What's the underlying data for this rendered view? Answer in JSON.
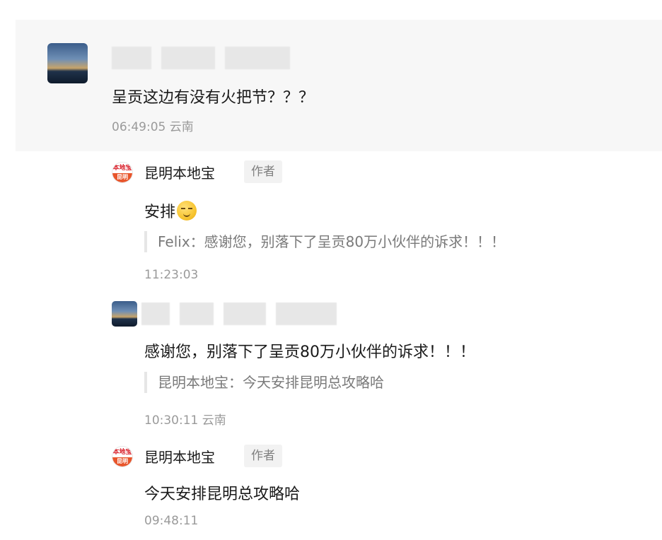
{
  "comment": {
    "username_blurred": true,
    "text": "呈贡这边有没有火把节？？？",
    "meta": "06:49:05 云南"
  },
  "replies": [
    {
      "author": "昆明本地宝",
      "badge": "作者",
      "text": "安排",
      "emoji": "smirk-emoji",
      "quote": "Felix：感谢您，别落下了呈贡80万小伙伴的诉求！！！",
      "time": "11:23:03"
    },
    {
      "username_blurred": true,
      "text": "感谢您，别落下了呈贡80万小伙伴的诉求！！！",
      "quote": "昆明本地宝：今天安排昆明总攻略哈",
      "meta": "10:30:11 云南"
    },
    {
      "author": "昆明本地宝",
      "badge": "作者",
      "text": "今天安排昆明总攻略哈",
      "time": "09:48:11"
    }
  ],
  "logo": {
    "top_text": "本地宝",
    "bottom_text": "昆明"
  }
}
